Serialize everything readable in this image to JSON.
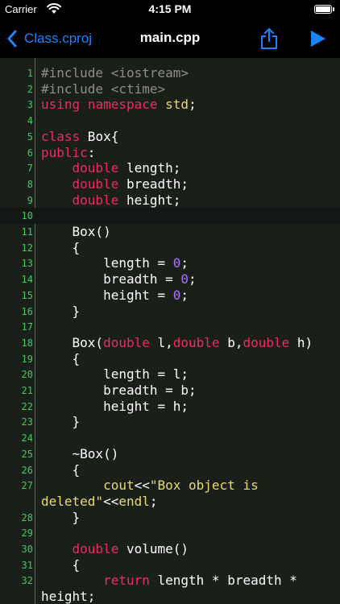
{
  "status_bar": {
    "carrier": "Carrier",
    "time": "4:15 PM"
  },
  "nav": {
    "back_label": "Class.cproj",
    "title": "main.cpp",
    "share_icon": "share-icon",
    "run_icon": "play-icon"
  },
  "colors": {
    "accent": "#1a84ff",
    "keyword": "#f0296a",
    "preprocessor": "#8f8f86",
    "number": "#a971ff",
    "string": "#e6db74",
    "line_number": "#3dcc5e",
    "editor_bg": "#1a1f1a"
  },
  "editor": {
    "lines": [
      {
        "n": "1",
        "tokens": [
          {
            "t": "#include <iostream>",
            "k": "pp"
          }
        ]
      },
      {
        "n": "2",
        "tokens": [
          {
            "t": "#include <ctime>",
            "k": "pp"
          }
        ]
      },
      {
        "n": "3",
        "tokens": [
          {
            "t": "using",
            "k": "kw"
          },
          {
            "t": " ",
            "k": ""
          },
          {
            "t": "namespace",
            "k": "kw"
          },
          {
            "t": " ",
            "k": ""
          },
          {
            "t": "std",
            "k": "str"
          },
          {
            "t": ";",
            "k": ""
          }
        ]
      },
      {
        "n": "4",
        "tokens": []
      },
      {
        "n": "5",
        "tokens": [
          {
            "t": "class",
            "k": "kw"
          },
          {
            "t": " Box{",
            "k": ""
          }
        ]
      },
      {
        "n": "6",
        "tokens": [
          {
            "t": "public",
            "k": "kw"
          },
          {
            "t": ":",
            "k": ""
          }
        ]
      },
      {
        "n": "7",
        "tokens": [
          {
            "t": "    ",
            "k": ""
          },
          {
            "t": "double",
            "k": "kw"
          },
          {
            "t": " length;",
            "k": ""
          }
        ]
      },
      {
        "n": "8",
        "tokens": [
          {
            "t": "    ",
            "k": ""
          },
          {
            "t": "double",
            "k": "kw"
          },
          {
            "t": " breadth;",
            "k": ""
          }
        ]
      },
      {
        "n": "9",
        "tokens": [
          {
            "t": "    ",
            "k": ""
          },
          {
            "t": "double",
            "k": "kw"
          },
          {
            "t": " height;",
            "k": ""
          }
        ]
      },
      {
        "n": "10",
        "tokens": [],
        "current": true
      },
      {
        "n": "11",
        "tokens": [
          {
            "t": "    Box()",
            "k": ""
          }
        ]
      },
      {
        "n": "12",
        "tokens": [
          {
            "t": "    {",
            "k": ""
          }
        ]
      },
      {
        "n": "13",
        "tokens": [
          {
            "t": "        length = ",
            "k": ""
          },
          {
            "t": "0",
            "k": "num"
          },
          {
            "t": ";",
            "k": ""
          }
        ]
      },
      {
        "n": "14",
        "tokens": [
          {
            "t": "        breadth = ",
            "k": ""
          },
          {
            "t": "0",
            "k": "num"
          },
          {
            "t": ";",
            "k": ""
          }
        ]
      },
      {
        "n": "15",
        "tokens": [
          {
            "t": "        height = ",
            "k": ""
          },
          {
            "t": "0",
            "k": "num"
          },
          {
            "t": ";",
            "k": ""
          }
        ]
      },
      {
        "n": "16",
        "tokens": [
          {
            "t": "    }",
            "k": ""
          }
        ]
      },
      {
        "n": "17",
        "tokens": []
      },
      {
        "n": "18",
        "tokens": [
          {
            "t": "    Box(",
            "k": ""
          },
          {
            "t": "double",
            "k": "kw"
          },
          {
            "t": " l,",
            "k": ""
          },
          {
            "t": "double",
            "k": "kw"
          },
          {
            "t": " b,",
            "k": ""
          },
          {
            "t": "double",
            "k": "kw"
          },
          {
            "t": " h)",
            "k": ""
          }
        ]
      },
      {
        "n": "19",
        "tokens": [
          {
            "t": "    {",
            "k": ""
          }
        ]
      },
      {
        "n": "20",
        "tokens": [
          {
            "t": "        length = l;",
            "k": ""
          }
        ]
      },
      {
        "n": "21",
        "tokens": [
          {
            "t": "        breadth = b;",
            "k": ""
          }
        ]
      },
      {
        "n": "22",
        "tokens": [
          {
            "t": "        height = h;",
            "k": ""
          }
        ]
      },
      {
        "n": "23",
        "tokens": [
          {
            "t": "    }",
            "k": ""
          }
        ]
      },
      {
        "n": "24",
        "tokens": []
      },
      {
        "n": "25",
        "tokens": [
          {
            "t": "    ~Box()",
            "k": ""
          }
        ]
      },
      {
        "n": "26",
        "tokens": [
          {
            "t": "    {",
            "k": ""
          }
        ]
      },
      {
        "n": "27",
        "tokens": [
          {
            "t": "        ",
            "k": ""
          },
          {
            "t": "cout",
            "k": "str"
          },
          {
            "t": "<<",
            "k": ""
          },
          {
            "t": "\"Box object is",
            "k": "str"
          }
        ]
      },
      {
        "n": "",
        "tokens": [
          {
            "t": "deleted\"",
            "k": "str"
          },
          {
            "t": "<<",
            "k": ""
          },
          {
            "t": "endl",
            "k": "str"
          },
          {
            "t": ";",
            "k": ""
          }
        ]
      },
      {
        "n": "28",
        "tokens": [
          {
            "t": "    }",
            "k": ""
          }
        ]
      },
      {
        "n": "29",
        "tokens": []
      },
      {
        "n": "30",
        "tokens": [
          {
            "t": "    ",
            "k": ""
          },
          {
            "t": "double",
            "k": "kw"
          },
          {
            "t": " volume()",
            "k": ""
          }
        ]
      },
      {
        "n": "31",
        "tokens": [
          {
            "t": "    {",
            "k": ""
          }
        ]
      },
      {
        "n": "32",
        "tokens": [
          {
            "t": "        ",
            "k": ""
          },
          {
            "t": "return",
            "k": "kw"
          },
          {
            "t": " length * breadth *",
            "k": ""
          }
        ]
      },
      {
        "n": "",
        "tokens": [
          {
            "t": "height;",
            "k": ""
          }
        ]
      }
    ]
  }
}
